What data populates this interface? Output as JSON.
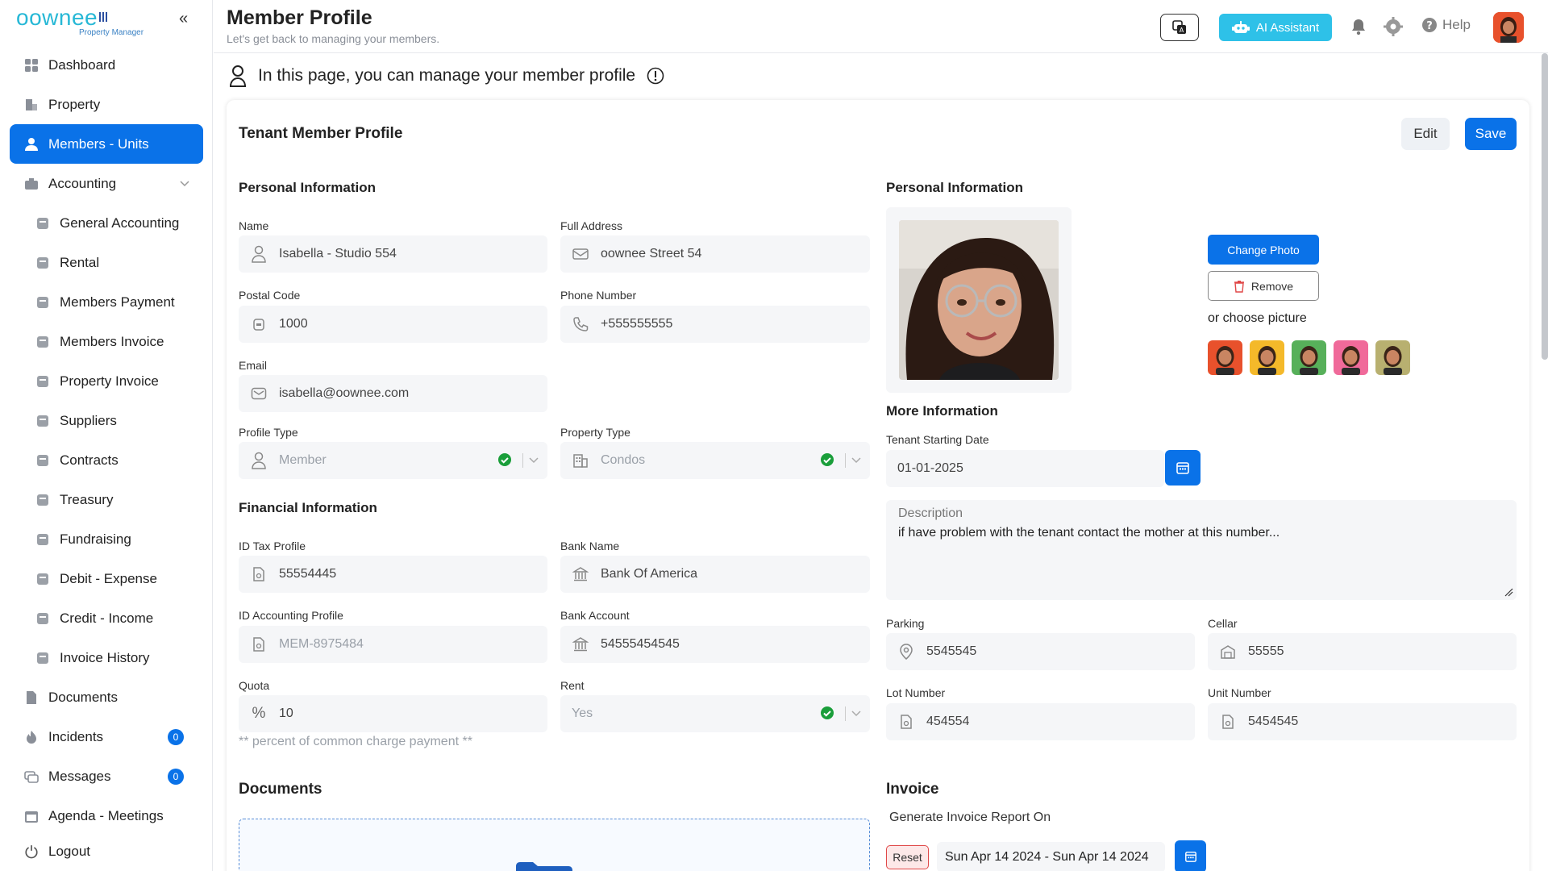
{
  "app": {
    "brand": "oownee",
    "brand_sub": "Property Manager",
    "collapse": "«"
  },
  "sidebar": {
    "items": [
      {
        "label": "Dashboard",
        "icon": "dashboard-icon",
        "active": false,
        "sub": false
      },
      {
        "label": "Property",
        "icon": "building-icon",
        "active": false,
        "sub": false
      },
      {
        "label": "Members - Units",
        "icon": "user-icon",
        "active": true,
        "sub": false
      },
      {
        "label": "Accounting",
        "icon": "briefcase-icon",
        "active": false,
        "sub": false,
        "expandable": true
      },
      {
        "label": "General Accounting",
        "icon": "ledger-icon",
        "active": false,
        "sub": true
      },
      {
        "label": "Rental",
        "icon": "coin-icon",
        "active": false,
        "sub": true
      },
      {
        "label": "Members Payment",
        "icon": "payment-icon",
        "active": false,
        "sub": true
      },
      {
        "label": "Members Invoice",
        "icon": "invoice-icon",
        "active": false,
        "sub": true
      },
      {
        "label": "Property Invoice",
        "icon": "invoice-icon",
        "active": false,
        "sub": true
      },
      {
        "label": "Suppliers",
        "icon": "truck-icon",
        "active": false,
        "sub": true
      },
      {
        "label": "Contracts",
        "icon": "contract-icon",
        "active": false,
        "sub": true
      },
      {
        "label": "Treasury",
        "icon": "treasury-icon",
        "active": false,
        "sub": true
      },
      {
        "label": "Fundraising",
        "icon": "piggy-icon",
        "active": false,
        "sub": true
      },
      {
        "label": "Debit - Expense",
        "icon": "wallet-icon",
        "active": false,
        "sub": true
      },
      {
        "label": "Credit - Income",
        "icon": "wallet-icon",
        "active": false,
        "sub": true
      },
      {
        "label": "Invoice History",
        "icon": "history-icon",
        "active": false,
        "sub": true
      },
      {
        "label": "Documents",
        "icon": "document-icon",
        "active": false,
        "sub": false
      },
      {
        "label": "Incidents",
        "icon": "fire-icon",
        "active": false,
        "sub": false,
        "count": "0"
      },
      {
        "label": "Messages",
        "icon": "chat-icon",
        "active": false,
        "sub": false,
        "count": "0"
      },
      {
        "label": "Agenda - Meetings",
        "icon": "calendar-icon",
        "active": false,
        "sub": false
      }
    ],
    "logout": "Logout"
  },
  "header": {
    "title": "Member Profile",
    "subtitle": "Let's get back to managing your members.",
    "ai_label": "AI Assistant",
    "help_label": "Help"
  },
  "banner": {
    "text": "In this page, you can manage your member profile"
  },
  "profile": {
    "title": "Tenant Member Profile",
    "edit_label": "Edit",
    "save_label": "Save",
    "personal_title": "Personal Information",
    "name_label": "Name",
    "name_value": "Isabella - Studio 554",
    "address_label": "Full Address",
    "address_value": "oownee Street 54",
    "postal_label": "Postal Code",
    "postal_value": "1000",
    "phone_label": "Phone Number",
    "phone_value": "+555555555",
    "email_label": "Email",
    "email_value": "isabella@oownee.com",
    "profile_type_label": "Profile Type",
    "profile_type_value": "Member",
    "property_type_label": "Property Type",
    "property_type_value": "Condos",
    "financial_title": "Financial Information",
    "tax_label": "ID Tax Profile",
    "tax_value": "55554445",
    "bank_name_label": "Bank Name",
    "bank_name_value": "Bank Of America",
    "acc_profile_label": "ID Accounting Profile",
    "acc_profile_value": "MEM-8975484",
    "bank_account_label": "Bank Account",
    "bank_account_value": "54555454545",
    "quota_label": "Quota",
    "quota_value": "10",
    "quota_symbol": "%",
    "rent_label": "Rent",
    "rent_value": "Yes",
    "quota_hint": "** percent of common charge payment **",
    "documents_title": "Documents"
  },
  "photo": {
    "title": "Personal Information",
    "change_label": "Change Photo",
    "remove_label": "Remove",
    "choose_label": "or choose picture",
    "avatar_colors": [
      "#e8512c",
      "#f4b92a",
      "#57b05a",
      "#f06a9a",
      "#b8b070"
    ]
  },
  "more": {
    "title": "More Information",
    "start_label": "Tenant Starting Date",
    "start_value": "01-01-2025",
    "desc_label": "Description",
    "desc_value": "if have problem with the tenant contact the mother at this number...",
    "parking_label": "Parking",
    "parking_value": "5545545",
    "cellar_label": "Cellar",
    "cellar_value": "55555",
    "lot_label": "Lot Number",
    "lot_value": "454554",
    "unit_label": "Unit Number",
    "unit_value": "5454545"
  },
  "invoice": {
    "title": "Invoice",
    "generate_label": "Generate Invoice Report On",
    "reset_label": "Reset",
    "range_value": "Sun Apr 14 2024 - Sun Apr 14 2024"
  },
  "colors": {
    "accent": "#0a72e8",
    "ai": "#2ec1e8",
    "success": "#1a9e3a"
  }
}
